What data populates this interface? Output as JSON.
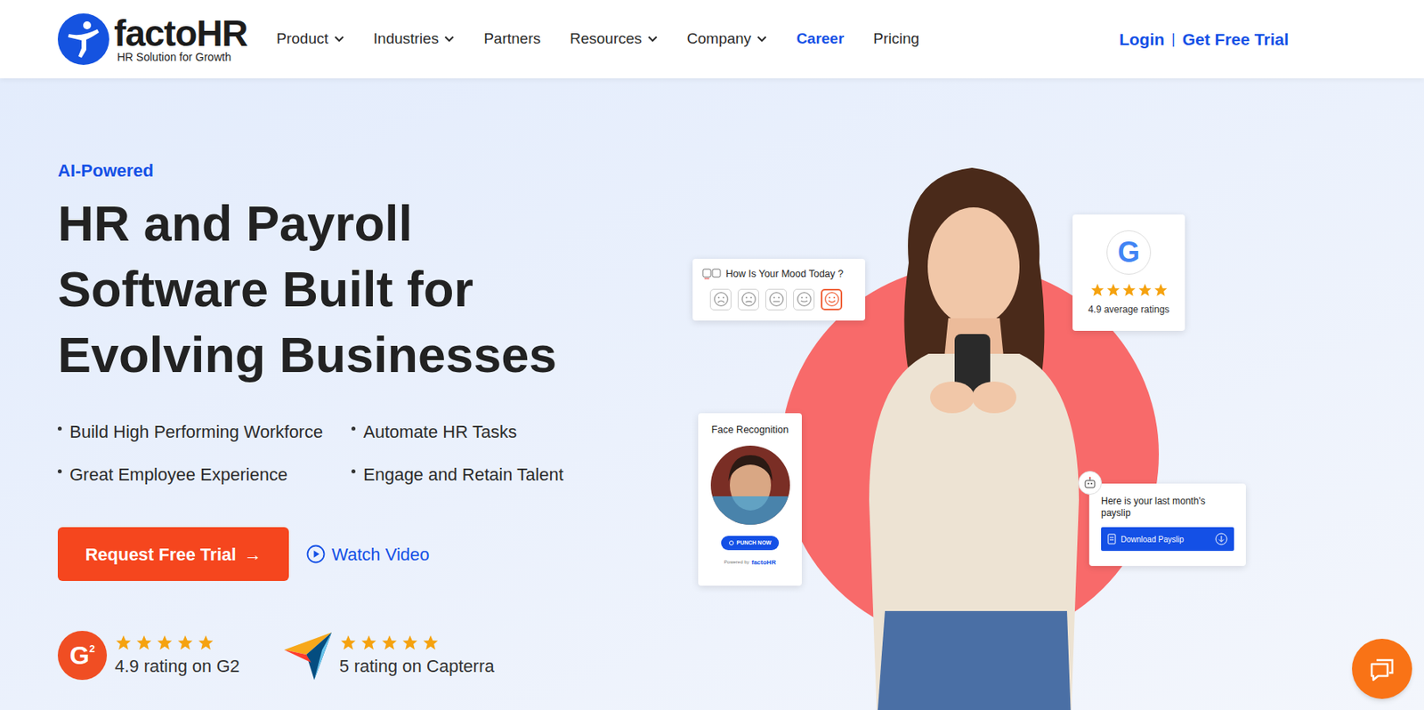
{
  "logo": {
    "name": "factoHR",
    "tagline": "HR Solution for Growth"
  },
  "nav": [
    {
      "label": "Product",
      "dropdown": true,
      "selected": false
    },
    {
      "label": "Industries",
      "dropdown": true,
      "selected": false
    },
    {
      "label": "Partners",
      "dropdown": false,
      "selected": false
    },
    {
      "label": "Resources",
      "dropdown": true,
      "selected": false
    },
    {
      "label": "Company",
      "dropdown": true,
      "selected": false
    },
    {
      "label": "Career",
      "dropdown": false,
      "selected": true
    },
    {
      "label": "Pricing",
      "dropdown": false,
      "selected": false
    }
  ],
  "auth": {
    "login": "Login",
    "separator": "|",
    "trial": "Get Free Trial"
  },
  "hero": {
    "eyebrow": "AI-Powered",
    "title": [
      "HR and Payroll",
      "Software Built for",
      "Evolving Businesses"
    ],
    "bullets": [
      "Build High Performing Workforce",
      "Automate HR Tasks",
      "Great Employee Experience",
      "Engage and Retain Talent"
    ],
    "cta": {
      "label": "Request Free Trial",
      "arrow": "→"
    },
    "video": "Watch Video"
  },
  "ratings": [
    {
      "kind": "g2",
      "logo": "G",
      "logo_sup": "2",
      "stars": 5,
      "text": "4.9 rating on G2"
    },
    {
      "kind": "capterra",
      "stars": 5,
      "text": "5 rating on Capterra"
    }
  ],
  "mood_card": {
    "title": "How Is Your Mood Today ?",
    "faces": [
      {
        "selected": false
      },
      {
        "selected": false
      },
      {
        "selected": false
      },
      {
        "selected": false
      },
      {
        "selected": true
      }
    ]
  },
  "google_card": {
    "logo": "G",
    "stars": 5,
    "text": "4.9 average ratings"
  },
  "face_card": {
    "title": "Face Recognition",
    "button": "PUNCH NOW",
    "footer": "Powered by",
    "brand": "factoHR"
  },
  "payslip_card": {
    "text": "Here is your last month's payslip",
    "button": "Download Payslip"
  }
}
